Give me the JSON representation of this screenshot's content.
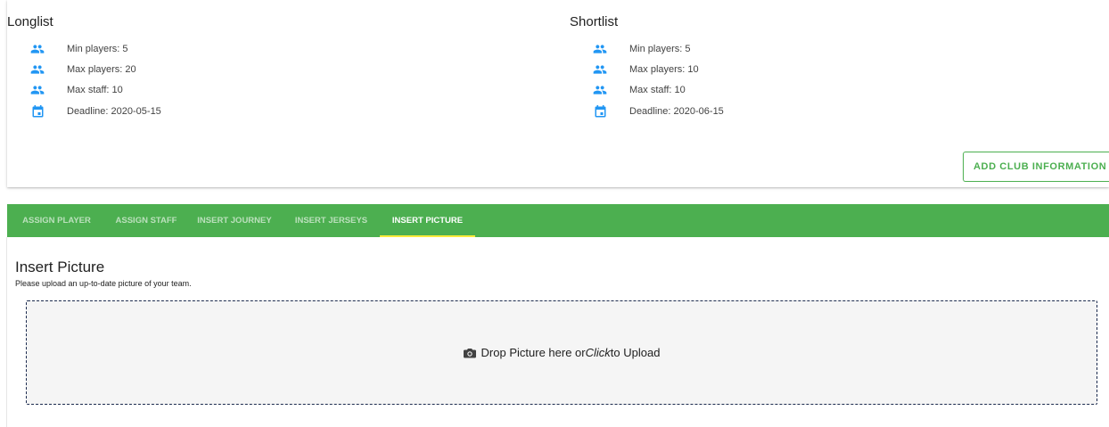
{
  "longlist": {
    "title": "Longlist",
    "items": [
      {
        "icon": "people-icon",
        "text": "Min players: 5"
      },
      {
        "icon": "people-icon",
        "text": "Max players: 20"
      },
      {
        "icon": "people-icon",
        "text": "Max staff: 10"
      },
      {
        "icon": "calendar-icon",
        "text": "Deadline: 2020-05-15"
      }
    ]
  },
  "shortlist": {
    "title": "Shortlist",
    "items": [
      {
        "icon": "people-icon",
        "text": "Min players: 5"
      },
      {
        "icon": "people-icon",
        "text": "Max players: 10"
      },
      {
        "icon": "people-icon",
        "text": "Max staff: 10"
      },
      {
        "icon": "calendar-icon",
        "text": "Deadline: 2020-06-15"
      }
    ]
  },
  "actions": {
    "add_club_info": "ADD CLUB INFORMATION"
  },
  "tabs": [
    {
      "label": "ASSIGN PLAYER",
      "active": false
    },
    {
      "label": "ASSIGN STAFF",
      "active": false
    },
    {
      "label": "INSERT JOURNEY",
      "active": false
    },
    {
      "label": "INSERT JERSEYS",
      "active": false
    },
    {
      "label": "INSERT PICTURE",
      "active": true
    }
  ],
  "section": {
    "title": "Insert Picture",
    "subtitle": "Please upload an up-to-date picture of your team."
  },
  "dropzone": {
    "text_before": "Drop Picture here or ",
    "text_emphasis": "Click",
    "text_after": " to Upload",
    "icon": "camera-icon"
  },
  "colors": {
    "primary_green": "#4caf50",
    "icon_blue": "#2196f3",
    "tab_indicator": "#ffeb3b",
    "dropzone_border": "#1b2a4e"
  }
}
